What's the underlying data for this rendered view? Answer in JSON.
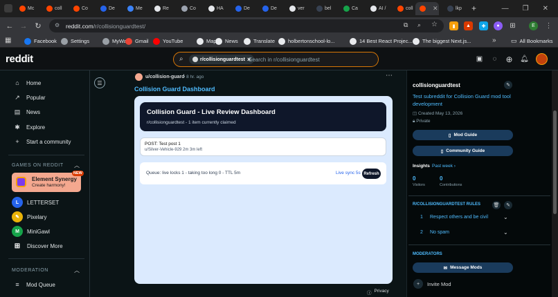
{
  "browser": {
    "tabs": [
      {
        "label": "Mc",
        "color": "#ff4500"
      },
      {
        "label": "coll",
        "color": "#ff4500"
      },
      {
        "label": "Co",
        "color": "#ff4500"
      },
      {
        "label": "De",
        "color": "#2563eb"
      },
      {
        "label": "Me",
        "color": "#3b82f6"
      },
      {
        "label": "Re",
        "color": "#e5e7eb"
      },
      {
        "label": "Co",
        "color": "#9ca3af"
      },
      {
        "label": "HA",
        "color": "#e5e7eb"
      },
      {
        "label": "De",
        "color": "#2563eb"
      },
      {
        "label": "De",
        "color": "#2563eb"
      },
      {
        "label": "ver",
        "color": "#e5e7eb"
      },
      {
        "label": "bel",
        "color": "#374151"
      },
      {
        "label": "Ca",
        "color": "#16a34a"
      },
      {
        "label": "AI /",
        "color": "#e5e7eb"
      },
      {
        "label": "coll",
        "color": "#ff4500"
      },
      {
        "label": "",
        "color": "#ff4500",
        "active": true
      },
      {
        "label": "lkp",
        "color": "#374151"
      }
    ],
    "new_tab": "+",
    "url_host": "reddit.com",
    "url_path": "/r/collisionguardtest/",
    "bookmarks": [
      {
        "label": "Facebook",
        "color": "#1877f2"
      },
      {
        "label": "Settings",
        "color": "#9aa0a6"
      },
      {
        "label": "MyWay",
        "color": "#9aa0a6"
      },
      {
        "label": "Gmail",
        "color": "#ea4335"
      },
      {
        "label": "YouTube",
        "color": "#ff0000"
      },
      {
        "label": "Maps",
        "color": "#e8eaed"
      },
      {
        "label": "News",
        "color": "#e8eaed"
      },
      {
        "label": "Translate",
        "color": "#e8eaed"
      },
      {
        "label": "holbertonschool-lo...",
        "color": "#e8eaed"
      },
      {
        "label": "14 Best React Projec...",
        "color": "#e8eaed"
      },
      {
        "label": "The biggest Next.js...",
        "color": "#e8eaed"
      }
    ],
    "all_bookmarks": "All Bookmarks",
    "more": "»"
  },
  "header": {
    "logo": "reddit",
    "search_chip": "r/collisionguardtest",
    "search_chip_close": "×",
    "search_placeholder": "Search in r/collisionguardtest"
  },
  "leftnav": {
    "items": [
      {
        "label": "Home",
        "icon": "⌂"
      },
      {
        "label": "Popular",
        "icon": "↗"
      },
      {
        "label": "News",
        "icon": "▤"
      },
      {
        "label": "Explore",
        "icon": "✱"
      },
      {
        "label": "Start a community",
        "icon": "+"
      }
    ],
    "games_header": "GAMES ON REDDIT",
    "games": [
      {
        "label": "Element Synergy",
        "sub": "Create harmony!",
        "color": "#f59e0b"
      },
      {
        "label": "LETTERSET",
        "color": "#2563eb"
      },
      {
        "label": "Pixelary",
        "color": "#eab308"
      },
      {
        "label": "MiniGawl",
        "color": "#16a34a"
      },
      {
        "label": "Discover More",
        "color": "#0b1416"
      }
    ],
    "new_badge": "NEW",
    "moderation_header": "MODERATION",
    "mod_queue": "Mod Queue"
  },
  "post": {
    "author": "u/collision-guard",
    "time": "• 8 hr. ago",
    "title": "Collision Guard Dashboard",
    "dashboard_title": "Collision Guard - Live Review Dashboard",
    "dashboard_sub": "r/collisionguardtest - 1 item currently claimed",
    "post_line": "POST:  Test post 1",
    "post_meta": "u/Silver-Vehicle-929  2m  3m left",
    "queue_text": "Queue: live locks 1 - taking too long 0 - TTL 5m",
    "live_sync": "Live sync 5s",
    "refresh": "Refresh",
    "privacy": "Privacy"
  },
  "sidebar": {
    "name": "collisionguardtest",
    "description": "Test subreddit for Collision Guard mod tool development",
    "created": "Created May 13, 2026",
    "privacy": "Private",
    "mod_guide": "Mod Guide",
    "community_guide": "Community Guide",
    "insights": "Insights",
    "past_week": "Past week ›",
    "visitors_value": "0",
    "visitors_label": "Visitors",
    "contributions_value": "0",
    "contributions_label": "Contributions",
    "rules_header": "R/COLLISIONGUARDTEST RULES",
    "rules": [
      {
        "num": "1",
        "text": "Respect others and be civil"
      },
      {
        "num": "2",
        "text": "No spam"
      }
    ],
    "moderators_header": "MODERATORS",
    "message_mods": "Message Mods",
    "invite_mod": "Invite Mod"
  }
}
